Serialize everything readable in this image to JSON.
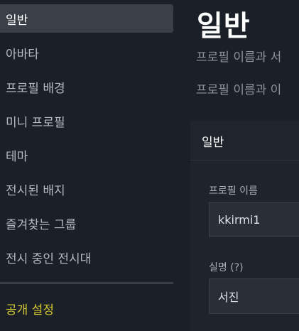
{
  "sidebar": {
    "items": [
      {
        "label": "일반",
        "active": true
      },
      {
        "label": "아바타"
      },
      {
        "label": "프로필 배경"
      },
      {
        "label": "미니 프로필"
      },
      {
        "label": "테마"
      },
      {
        "label": "전시된 배지"
      },
      {
        "label": "즐겨찾는 그룹"
      },
      {
        "label": "전시 중인 전시대"
      }
    ],
    "privacy_label": "공개 설정"
  },
  "main": {
    "title": "일반",
    "description_lines": [
      "프로필 이름과 서",
      "프로필 이름과 이"
    ],
    "section_title": "일반",
    "profile_name": {
      "label": "프로필 이름",
      "value": "kkirmi1"
    },
    "real_name": {
      "label": "실명 (?)",
      "value": "서진"
    }
  },
  "colors": {
    "background": "#1b2028",
    "active_item": "#3a3f48",
    "privacy_accent": "#d4c92e",
    "input_bg": "#2a2f37"
  }
}
